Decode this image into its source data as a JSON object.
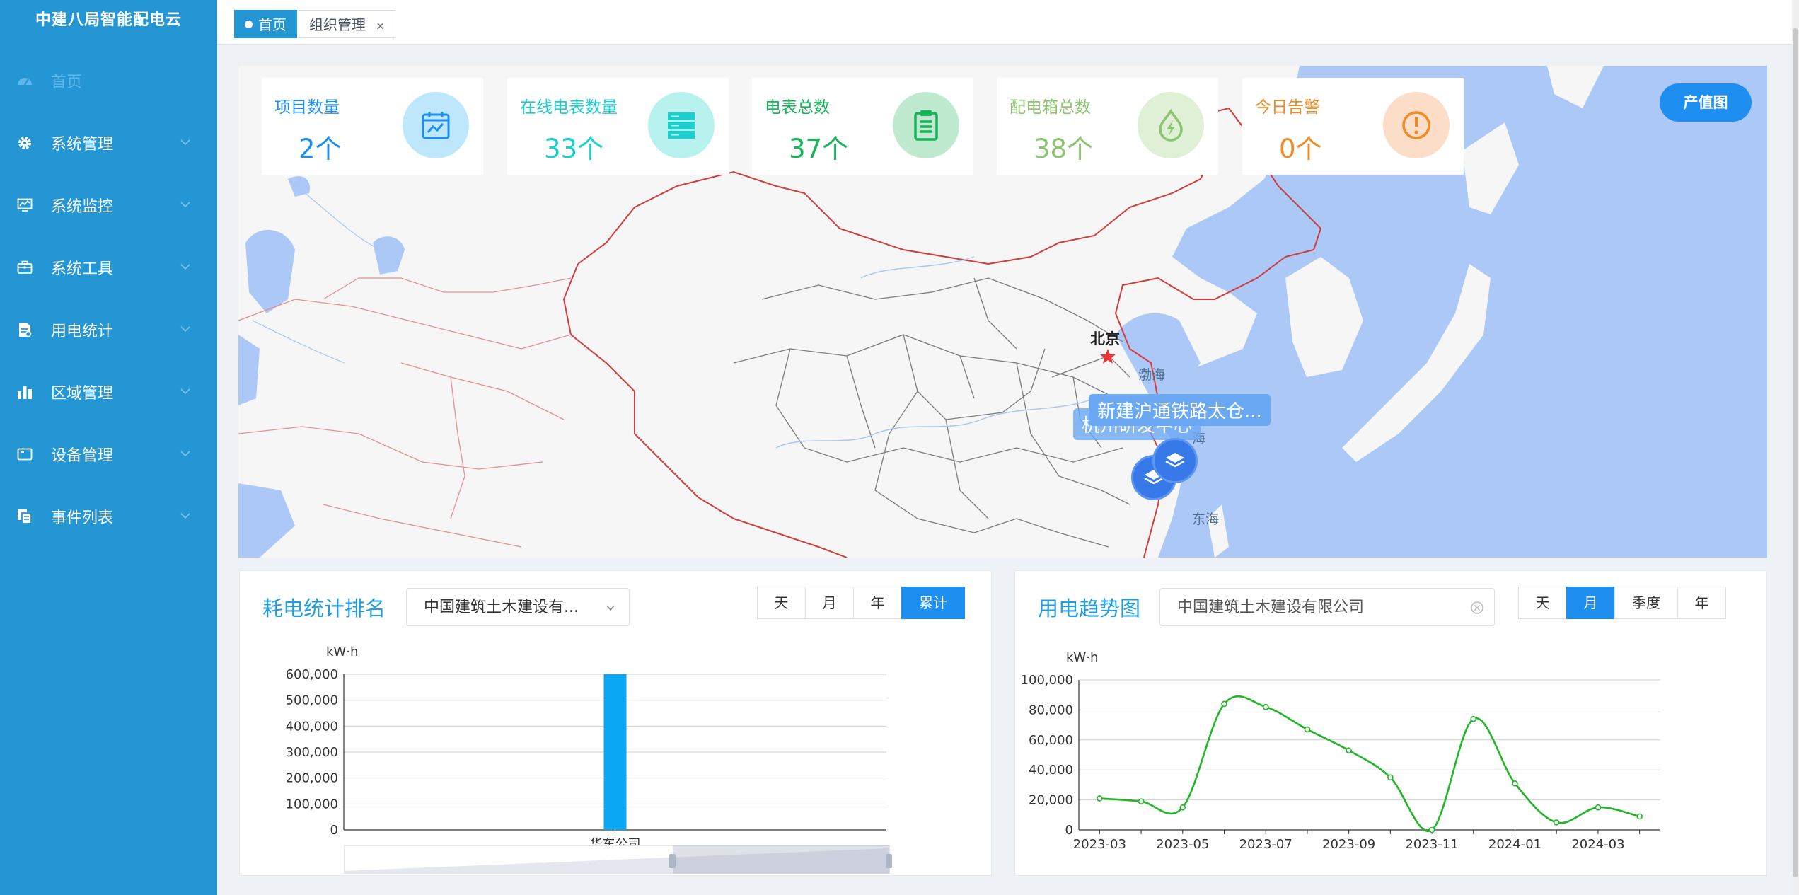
{
  "app": {
    "title": "中建八局智能配电云"
  },
  "sidebar": {
    "items": [
      {
        "label": "首页",
        "icon": "dashboard-icon"
      },
      {
        "label": "系统管理",
        "icon": "gear-icon"
      },
      {
        "label": "系统监控",
        "icon": "monitor-icon"
      },
      {
        "label": "系统工具",
        "icon": "toolbox-icon"
      },
      {
        "label": "用电统计",
        "icon": "document-icon"
      },
      {
        "label": "区域管理",
        "icon": "bar-chart-icon"
      },
      {
        "label": "设备管理",
        "icon": "device-icon"
      },
      {
        "label": "事件列表",
        "icon": "copy-icon"
      }
    ]
  },
  "tabs": [
    {
      "label": "首页",
      "active": true
    },
    {
      "label": "组织管理",
      "close": "×"
    }
  ],
  "stats": [
    {
      "title": "项目数量",
      "value": "2个",
      "color": "#1e8ff0",
      "icon": "calendar-chart-icon"
    },
    {
      "title": "在线电表数量",
      "value": "33个",
      "color": "#1ccfcf",
      "icon": "server-icon"
    },
    {
      "title": "电表总数",
      "value": "37个",
      "color": "#17b35a",
      "icon": "clipboard-icon"
    },
    {
      "title": "配电箱总数",
      "value": "38个",
      "color": "#8dc472",
      "icon": "lightning-drop-icon"
    },
    {
      "title": "今日告警",
      "value": "0个",
      "color": "#f08a24",
      "icon": "alert-icon"
    }
  ],
  "map": {
    "output_button": "产值图",
    "city": "北京",
    "sea_bohai": "渤海",
    "sea_donghai": "东海",
    "sea_huanghai": "海",
    "pin_label_front": "新建沪通铁路太仓...",
    "pin_label_back": "杭州研发中心"
  },
  "ranking_panel": {
    "title": "耗电统计排名",
    "select_value": "中国建筑土木建设有...",
    "periods": [
      "天",
      "月",
      "年",
      "累计"
    ],
    "active_period": "累计",
    "unit": "kW·h"
  },
  "trend_panel": {
    "title": "用电趋势图",
    "select_value": "中国建筑土木建设有限公司",
    "periods": [
      "天",
      "月",
      "季度",
      "年"
    ],
    "active_period": "月",
    "unit": "kW·h"
  },
  "chart_data": [
    {
      "type": "bar",
      "ylabel": "kW·h",
      "categories": [
        "华东公司"
      ],
      "values": [
        600000
      ],
      "yticks": [
        0,
        100000,
        200000,
        300000,
        400000,
        500000,
        600000
      ],
      "ytick_labels": [
        "0",
        "100,000",
        "200,000",
        "300,000",
        "400,000",
        "500,000",
        "600,000"
      ],
      "ylim": [
        0,
        600000
      ],
      "color": "#0aa7f5",
      "grid": true,
      "data_zoom": true
    },
    {
      "type": "line",
      "ylabel": "kW·h",
      "x": [
        "2023-03",
        "2023-04",
        "2023-05",
        "2023-06",
        "2023-07",
        "2023-08",
        "2023-09",
        "2023-10",
        "2023-11",
        "2023-12",
        "2024-01",
        "2024-02",
        "2024-03",
        "2024-04"
      ],
      "series": [
        {
          "values": [
            21000,
            19000,
            15000,
            84000,
            82000,
            67000,
            53000,
            35000,
            0,
            74000,
            31000,
            5000,
            15000,
            9000
          ],
          "color": "#21b627"
        }
      ],
      "xtick_labels": [
        "2023-03",
        "2023-05",
        "2023-07",
        "2023-09",
        "2023-11",
        "2024-01",
        "2024-03"
      ],
      "yticks": [
        0,
        20000,
        40000,
        60000,
        80000,
        100000
      ],
      "ytick_labels": [
        "0",
        "20,000",
        "40,000",
        "60,000",
        "80,000",
        "100,000"
      ],
      "ylim": [
        0,
        100000
      ],
      "grid": true
    }
  ]
}
